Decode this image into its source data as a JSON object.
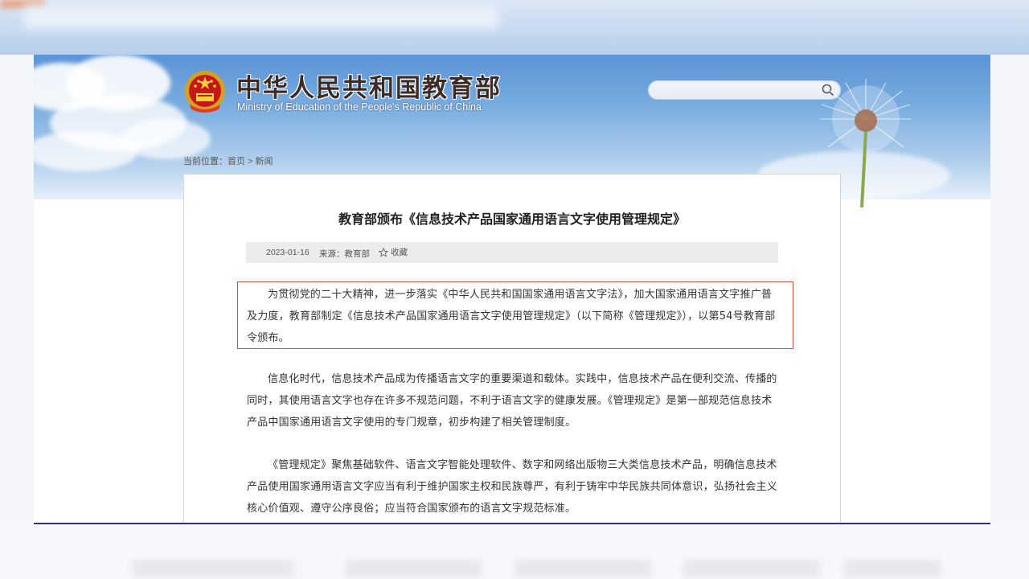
{
  "header": {
    "title": "中华人民共和国教育部",
    "subtitle": "Ministry of Education of the People's Republic of China",
    "search_placeholder": ""
  },
  "breadcrumb": {
    "prefix": "当前位置：",
    "home": "首页",
    "separator": " > ",
    "current": "新闻"
  },
  "article": {
    "title": "教育部颁布《信息技术产品国家通用语言文字使用管理规定》",
    "date": "2023-01-16",
    "source": "来源：教育部",
    "favorite_label": "收藏",
    "paragraphs": [
      "为贯彻党的二十大精神，进一步落实《中华人民共和国国家通用语言文字法》，加大国家通用语言文字推广普及力度，教育部制定《信息技术产品国家通用语言文字使用管理规定》（以下简称《管理规定》），以第54号教育部令颁布。",
      "信息化时代，信息技术产品成为传播语言文字的重要渠道和载体。实践中，信息技术产品在便利交流、传播的同时，其使用语言文字也存在许多不规范问题，不利于语言文字的健康发展。《管理规定》是第一部规范信息技术产品中国家通用语言文字使用的专门规章，初步构建了相关管理制度。",
      "《管理规定》聚焦基础软件、语言文字智能处理软件、数字和网络出版物三大类信息技术产品，明确信息技术产品使用国家通用语言文字应当有利于维护国家主权和民族尊严，有利于铸牢中华民族共同体意识，弘扬社会主义核心价值观、遵守公序良俗；应当符合国家颁布的语言文字规范标准。"
    ]
  },
  "colors": {
    "header_blue": "#5b94d6",
    "highlight_red": "#e04a3c",
    "meta_bar": "#ececec",
    "frame_bottom": "#3a2a8a"
  },
  "icons": {
    "emblem": "national-emblem-icon",
    "search": "search-icon",
    "favorite": "star-icon"
  }
}
